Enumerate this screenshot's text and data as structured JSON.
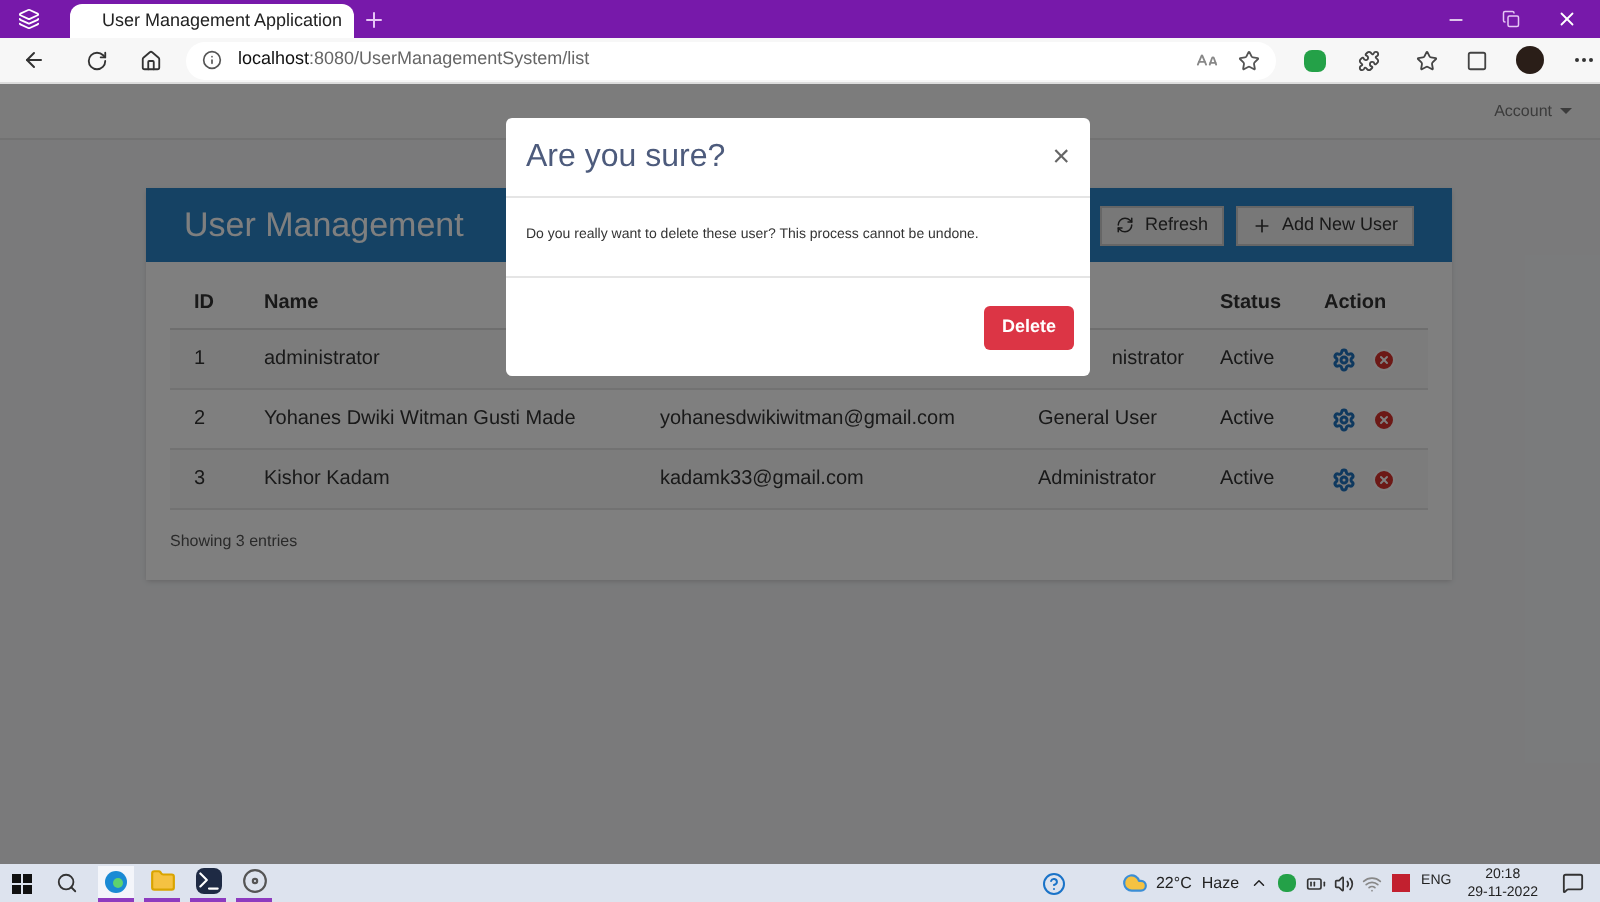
{
  "browser": {
    "tab_title": "User Management Application",
    "url_host": "localhost",
    "url_path": ":8080/UserManagementSystem/list"
  },
  "navbar": {
    "account": "Account"
  },
  "card": {
    "title": "User Management",
    "buttons": [
      "Refresh",
      "Add New User"
    ]
  },
  "table": {
    "header": {
      "id": "ID",
      "name": "Name",
      "status": "Status",
      "action": "Action"
    },
    "rows": [
      {
        "id": "1",
        "name": "administrator",
        "role": "nistrator",
        "status": "Active",
        "covered": true
      },
      {
        "id": "2",
        "name": "Yohanes Dwiki Witman Gusti Made",
        "email": "yohanesdwikiwitman@gmail.com",
        "role": "General User",
        "status": "Active",
        "covered": false
      },
      {
        "id": "3",
        "name": "Kishor Kadam",
        "email": "kadamk33@gmail.com",
        "role": "Administrator",
        "status": "Active",
        "covered": false
      }
    ],
    "footer": "Showing 3 entries"
  },
  "modal": {
    "title": "Are you sure?",
    "close": "×",
    "message": "Do you really want to delete these user? This process cannot be undone.",
    "confirm": "Delete"
  },
  "taskbar": {
    "apps": [
      {
        "kind": "browser",
        "selected": true
      },
      {
        "kind": "folder",
        "selected": false
      },
      {
        "kind": "terminal",
        "selected": false
      },
      {
        "kind": "disc",
        "selected": false
      }
    ],
    "temperature": "22°C",
    "weather": "Haze",
    "language": "ENG",
    "time": "20:18",
    "date": "29-11-2022"
  }
}
